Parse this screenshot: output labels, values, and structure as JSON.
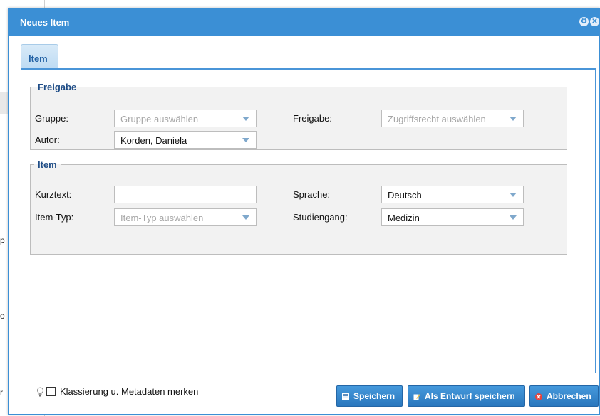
{
  "background": {
    "chars": [
      "p",
      "o",
      "r"
    ]
  },
  "dialog": {
    "title": "Neues Item",
    "title_icons": [
      "gear-icon",
      "close-icon"
    ]
  },
  "tabs": [
    {
      "label": "Item",
      "active": true
    }
  ],
  "freigabe": {
    "legend": "Freigabe",
    "gruppe": {
      "label": "Gruppe:",
      "placeholder": "Gruppe auswählen"
    },
    "freigabe_field": {
      "label": "Freigabe:",
      "placeholder": "Zugriffsrecht auswählen"
    },
    "autor": {
      "label": "Autor:",
      "value": "Korden, Daniela"
    }
  },
  "item": {
    "legend": "Item",
    "kurztext": {
      "label": "Kurztext:",
      "value": ""
    },
    "sprache": {
      "label": "Sprache:",
      "value": "Deutsch"
    },
    "item_typ": {
      "label": "Item-Typ:",
      "placeholder": "Item-Typ auswählen"
    },
    "studiengang": {
      "label": "Studiengang:",
      "value": "Medizin"
    }
  },
  "footer": {
    "checkbox_label": "Klassierung u. Metadaten merken",
    "checkbox_checked": false,
    "buttons": {
      "save": "Speichern",
      "draft": "Als Entwurf speichern",
      "cancel": "Abbrechen"
    }
  },
  "colors": {
    "accent": "#3b8fd5",
    "legend": "#1f4d87",
    "cancel_icon": "#e8423b"
  }
}
